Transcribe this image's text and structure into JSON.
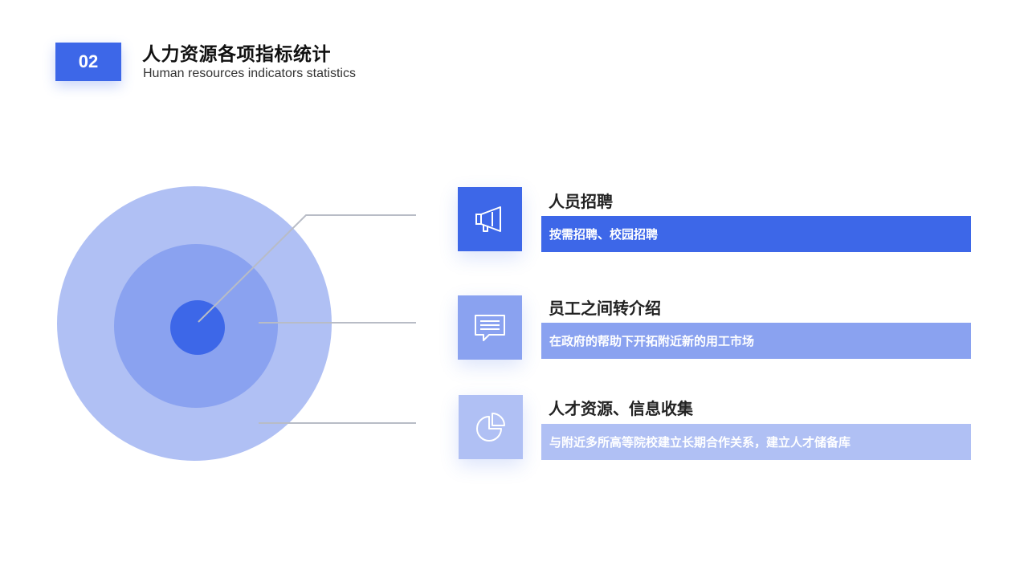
{
  "header": {
    "number": "02",
    "title": "人力资源各项指标统计",
    "subtitle": "Human resources indicators statistics"
  },
  "colors": {
    "primary": "#3d67e8",
    "medium": "#8aa2f0",
    "light": "#b0c0f4",
    "connector": "#b8bcc6"
  },
  "items": [
    {
      "icon": "megaphone-icon",
      "title": "人员招聘",
      "description": "按需招聘、校园招聘"
    },
    {
      "icon": "message-icon",
      "title": "员工之间转介绍",
      "description": "在政府的帮助下开拓附近新的用工市场"
    },
    {
      "icon": "pie-chart-icon",
      "title": "人才资源、信息收集",
      "description": "与附近多所高等院校建立长期合作关系，建立人才储备库"
    }
  ]
}
